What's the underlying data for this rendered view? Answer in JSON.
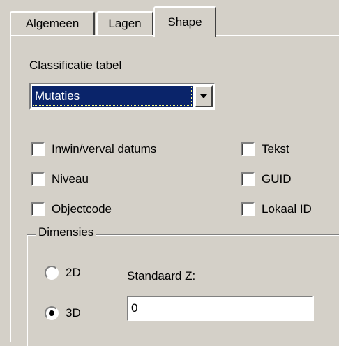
{
  "tabs": [
    {
      "label": "Algemeen"
    },
    {
      "label": "Lagen"
    },
    {
      "label": "Shape",
      "active": true
    }
  ],
  "classification": {
    "label": "Classificatie tabel",
    "selected": "Mutaties"
  },
  "options": {
    "inwin_verval": {
      "label": "Inwin/verval datums",
      "checked": false
    },
    "niveau": {
      "label": "Niveau",
      "checked": false
    },
    "objectcode": {
      "label": "Objectcode",
      "checked": false
    },
    "tekst": {
      "label": "Tekst",
      "checked": false
    },
    "guid": {
      "label": "GUID",
      "checked": false
    },
    "lokaal_id": {
      "label": "Lokaal ID",
      "checked": false
    }
  },
  "dimensions": {
    "legend": "Dimensies",
    "option_2d": {
      "label": "2D",
      "selected": false
    },
    "option_3d": {
      "label": "3D",
      "selected": true
    },
    "z_label": "Standaard Z:",
    "z_value": "0"
  },
  "colors": {
    "face": "#d4d0c8",
    "selection": "#0a246a"
  }
}
